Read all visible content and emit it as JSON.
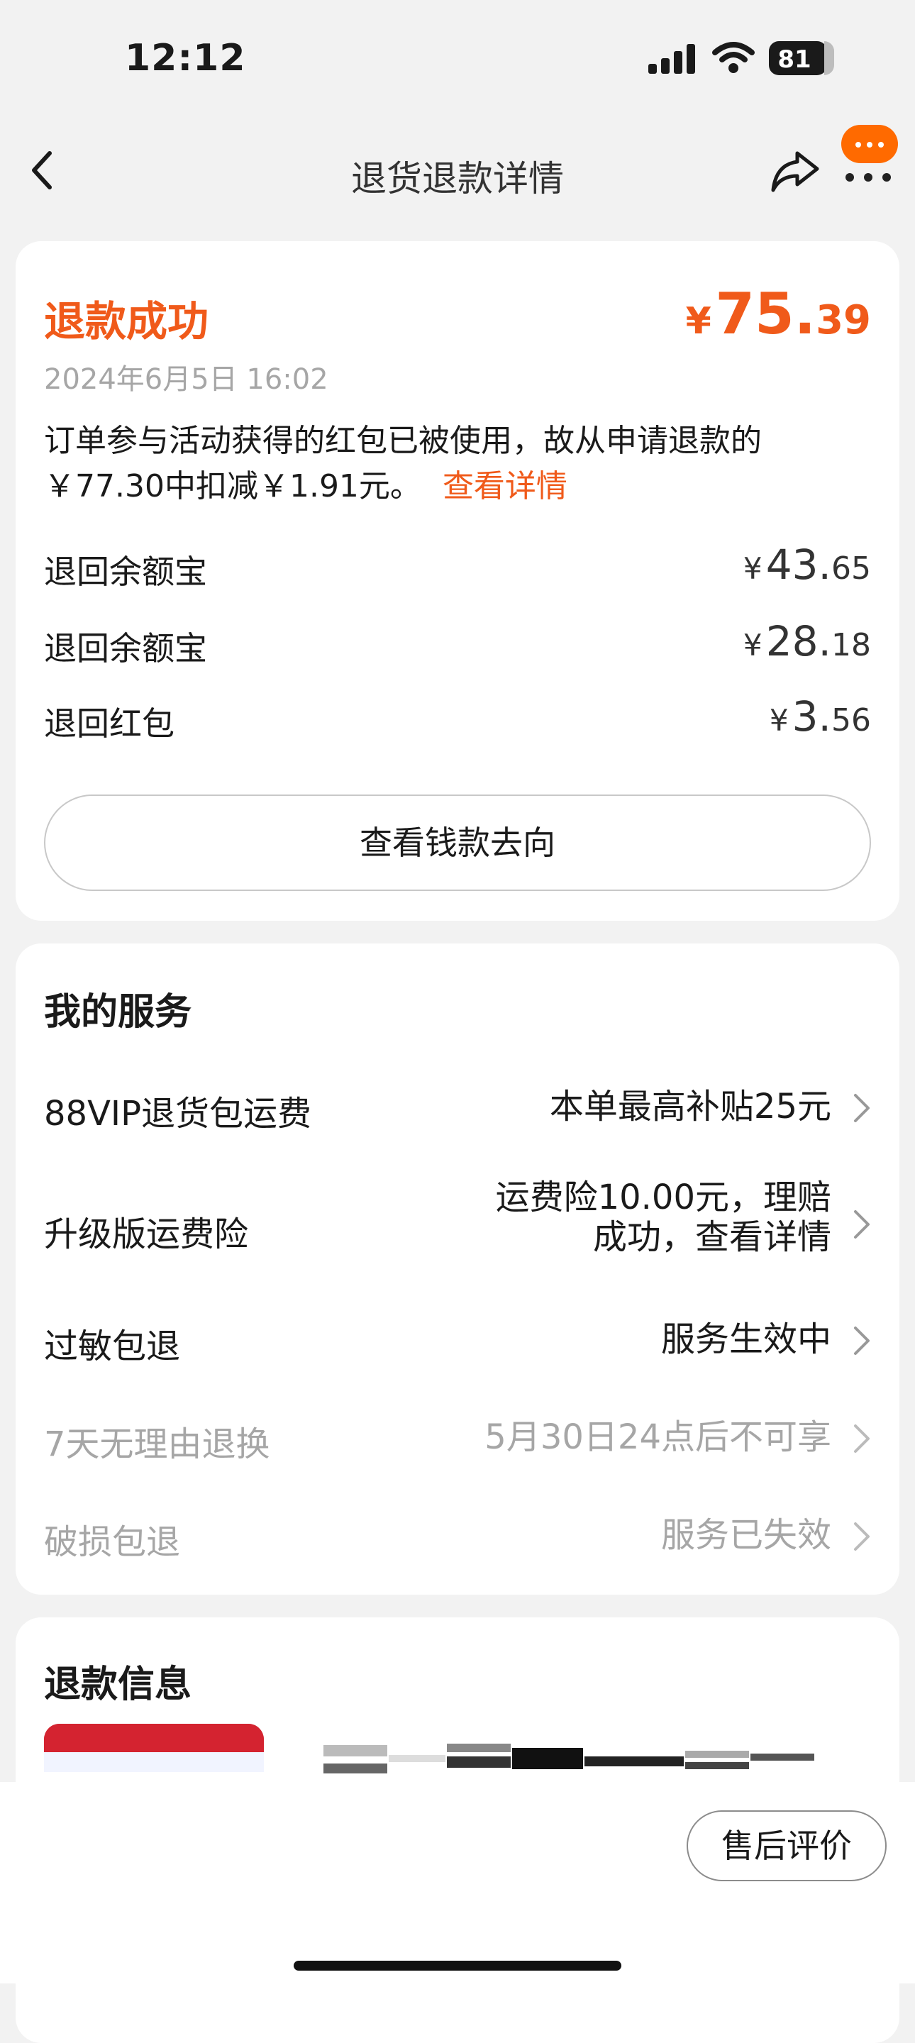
{
  "status_bar": {
    "time": "12:12",
    "battery": "81"
  },
  "nav": {
    "title": "退货退款详情"
  },
  "refund_status": {
    "title": "退款成功",
    "amount_symbol": "¥",
    "amount_int": "75.",
    "amount_dec": "39",
    "date": "2024年6月5日 16:02",
    "notice": "订单参与活动获得的红包已被使用，故从申请退款的￥77.30中扣减￥1.91元。",
    "notice_link": "查看详情",
    "breakdown": [
      {
        "label": "退回余额宝",
        "symbol": "¥",
        "int": "43.",
        "dec": "65"
      },
      {
        "label": "退回余额宝",
        "symbol": "¥",
        "int": "28.",
        "dec": "18"
      },
      {
        "label": "退回红包",
        "symbol": "¥",
        "int": "3.",
        "dec": "56"
      }
    ],
    "track_button": "查看钱款去向"
  },
  "services": {
    "title": "我的服务",
    "items": [
      {
        "name": "88VIP退货包运费",
        "value": "本单最高补贴25元",
        "active": true
      },
      {
        "name": "升级版运费险",
        "value_line1": "运费险10.00元，理赔",
        "value_line2": "成功，查看详情",
        "active": true
      },
      {
        "name": "过敏包退",
        "value": "服务生效中",
        "active": true
      },
      {
        "name": "7天无理由退换",
        "value": "5月30日24点后不可享",
        "active": false
      },
      {
        "name": "破损包退",
        "value": "服务已失效",
        "active": false
      }
    ]
  },
  "refund_info": {
    "title": "退款信息"
  },
  "bottom": {
    "review_button": "售后评价"
  },
  "colors": {
    "accent": "#f05a1a",
    "more_bubble": "#ff6a00",
    "muted": "#a6a6a6"
  },
  "icons": [
    "back-chevron-icon",
    "share-icon",
    "more-icon",
    "chevron-right-icon",
    "signal-icon",
    "wifi-icon",
    "battery-icon"
  ]
}
